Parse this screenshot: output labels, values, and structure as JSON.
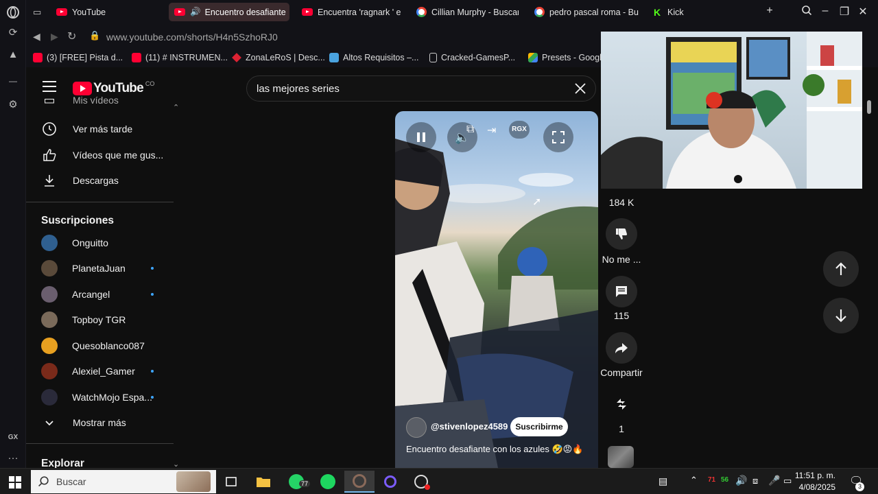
{
  "tabs": [
    {
      "label": "YouTube"
    },
    {
      "label": "Encuentro desafiante"
    },
    {
      "label": "Encuentra 'ragnark ' en"
    },
    {
      "label": "Cillian Murphy - Buscar"
    },
    {
      "label": "pedro pascal roma - Bu"
    },
    {
      "label": "Kick"
    }
  ],
  "address": {
    "url": "www.youtube.com/shorts/H4n5SzhoRJ0"
  },
  "bookmarks": [
    {
      "label": "(3) [FREE] Pista d..."
    },
    {
      "label": "(11) # INSTRUMEN..."
    },
    {
      "label": "ZonaLeRoS | Desc..."
    },
    {
      "label": "Altos Requisitos –..."
    },
    {
      "label": "Cracked-GamesP..."
    },
    {
      "label": "Presets - Googl"
    }
  ],
  "youtube": {
    "logo_text": "YouTube",
    "region": "CO",
    "search_value": "las mejores series",
    "sidebar": {
      "partial_item": "Mis vídeos",
      "items": [
        {
          "label": "Ver más tarde",
          "icon": "clock-icon"
        },
        {
          "label": "Vídeos que me gus...",
          "icon": "thumbs-up-icon"
        },
        {
          "label": "Descargas",
          "icon": "download-icon"
        }
      ],
      "subs_title": "Suscripciones",
      "subscriptions": [
        {
          "name": "Onguitto",
          "color": "#2f5f8f",
          "new": false
        },
        {
          "name": "PlanetaJuan",
          "color": "#5a4a3a",
          "new": true
        },
        {
          "name": "Arcangel",
          "color": "#6a5e6e",
          "new": true
        },
        {
          "name": "Topboy TGR",
          "color": "#7a6a5a",
          "new": false
        },
        {
          "name": "Quesoblanco087",
          "color": "#e8a020",
          "new": false
        },
        {
          "name": "Alexiel_Gamer",
          "color": "#7a2a1a",
          "new": true
        },
        {
          "name": "WatchMojo Espa...",
          "color": "#2a2a3a",
          "new": true
        }
      ],
      "show_more": "Mostrar más",
      "explore_title": "Explorar"
    },
    "short": {
      "channel": "@stivenlopez4589",
      "subscribe": "Suscribirme",
      "title": "Encuentro desafiante con los azules 🤣😡🔥",
      "badge": "RGX"
    },
    "actions": {
      "likes": "184 K",
      "dislike_label": "No me ...",
      "comments": "115",
      "share_label": "Compartir",
      "remix_count": "1"
    }
  },
  "taskbar": {
    "search_placeholder": "Buscar",
    "whatsapp_badge": "77",
    "tray_temp": "71",
    "tray_net": "56",
    "time": "11:51 p. m.",
    "date": "4/08/2025",
    "notifications": "3"
  },
  "gx_label": "GX",
  "colors": {
    "yt_red": "#ff0033",
    "accent_blue": "#3ea6ff",
    "tab_active": "#3a2a2d"
  }
}
